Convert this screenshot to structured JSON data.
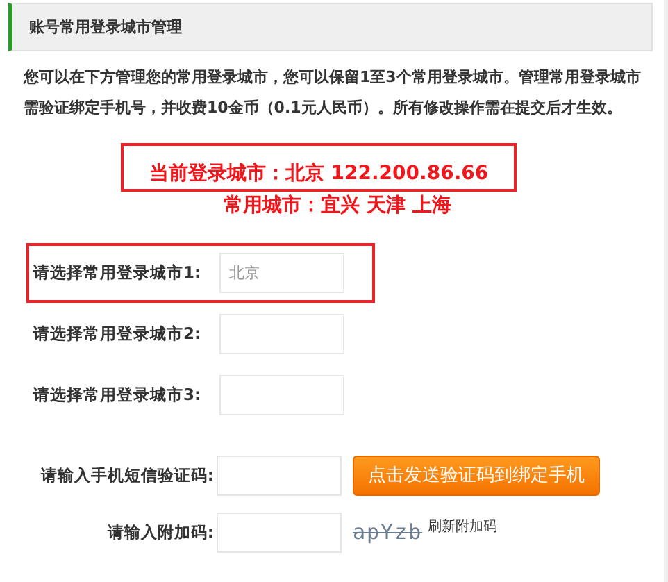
{
  "header": {
    "title": "账号常用登录城市管理"
  },
  "intro": "您可以在下方管理您的常用登录城市，您可以保留1至3个常用登录城市。管理常用登录城市需验证绑定手机号，并收费10金币（0.1元人民币）。所有修改操作需在提交后才生效。",
  "current": {
    "label": "当前登录城市：",
    "city": "北京",
    "ip": "122.200.86.66"
  },
  "common": {
    "label": "常用城市：",
    "cities": [
      "宜兴",
      "天津",
      "上海"
    ]
  },
  "cities": [
    {
      "label": "请选择常用登录城市1:",
      "placeholder": "北京",
      "highlighted": true
    },
    {
      "label": "请选择常用登录城市2:",
      "highlighted": false
    },
    {
      "label": "请选择常用登录城市3:",
      "highlighted": false
    }
  ],
  "sms": {
    "label": "请输入手机短信验证码:",
    "button": "点击发送验证码到绑定手机"
  },
  "captcha": {
    "label": "请输入附加码:",
    "code": "apYzb",
    "refresh": "刷新附加码"
  }
}
